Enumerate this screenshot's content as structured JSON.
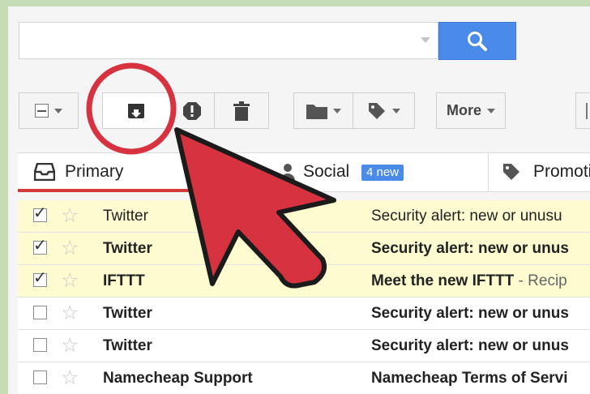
{
  "search": {
    "placeholder": ""
  },
  "toolbar": {
    "more_label": "More"
  },
  "tabs": [
    {
      "label": "Primary",
      "icon": "inbox-icon"
    },
    {
      "label": "Social",
      "icon": "people-icon",
      "badge": "4 new"
    },
    {
      "label": "Promoti",
      "icon": "tag-icon"
    }
  ],
  "emails": [
    {
      "sender": "Twitter",
      "subject": "Security alert: new or unusu",
      "snippet": "",
      "checked": true,
      "unread": false
    },
    {
      "sender": "Twitter",
      "subject": "Security alert: new or unus",
      "snippet": "",
      "checked": true,
      "unread": true
    },
    {
      "sender": "IFTTT",
      "subject": "Meet the new IFTTT",
      "snippet": " - Recip",
      "checked": true,
      "unread": true
    },
    {
      "sender": "Twitter",
      "subject": "Security alert: new or unus",
      "snippet": "",
      "checked": false,
      "unread": true
    },
    {
      "sender": "Twitter",
      "subject": "Security alert: new or unus",
      "snippet": "",
      "checked": false,
      "unread": true
    },
    {
      "sender": "Namecheap Support",
      "subject": "Namecheap Terms of Servi",
      "snippet": "",
      "checked": false,
      "unread": true
    }
  ],
  "colors": {
    "accent_blue": "#4a8ae8",
    "annotation_red": "#d7323f",
    "selected_row": "#fefbd1"
  }
}
